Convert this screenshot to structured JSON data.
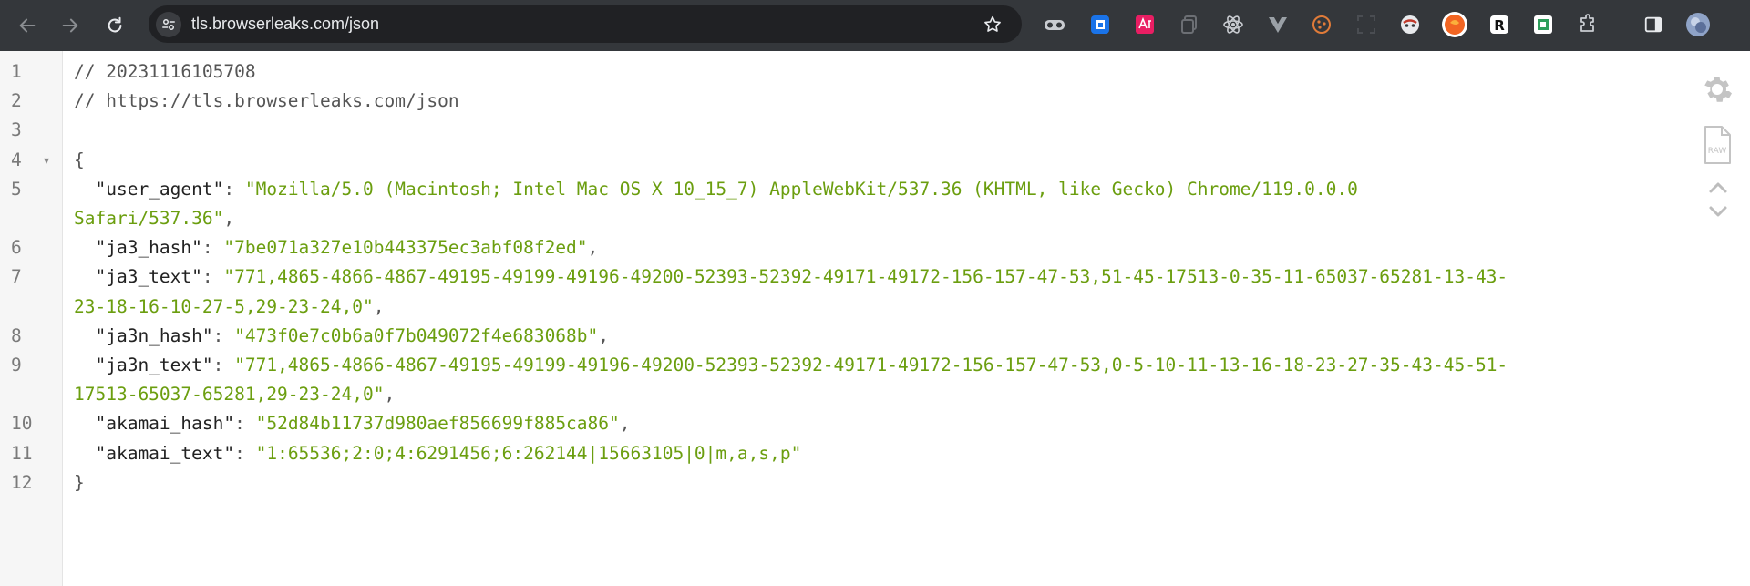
{
  "browser": {
    "url": "tls.browserleaks.com/json",
    "buttons": [
      "back-icon",
      "forward-icon",
      "reload-icon"
    ]
  },
  "extensions": [
    "privacy-mask-icon",
    "translate-extension-icon",
    "extension-icon",
    "copy-extension-icon",
    "react-devtools-icon",
    "vue-devtools-icon",
    "cookie-icon",
    "screenshot-icon",
    "dark-reader-icon",
    "orange-extension-icon",
    "r-extension-icon",
    "green-extension-icon",
    "puzzle-icon",
    "side-panel-icon",
    "profile-avatar"
  ],
  "viewer": {
    "lines": [
      {
        "n": "1",
        "text": "// 20231116105708"
      },
      {
        "n": "2",
        "text": "// https://tls.browserleaks.com/json"
      },
      {
        "n": "3",
        "text": ""
      },
      {
        "n": "4",
        "brace": "{"
      },
      {
        "n": "5",
        "key": "\"user_agent\"",
        "value": "\"Mozilla/5.0 (Macintosh; Intel Mac OS X 10_15_7) AppleWebKit/537.36 (KHTML, like Gecko) Chrome/119.0.0.0",
        "cont": "Safari/537.36\""
      },
      {
        "n": "6",
        "key": "\"ja3_hash\"",
        "value": "\"7be071a327e10b443375ec3abf08f2ed\""
      },
      {
        "n": "7",
        "key": "\"ja3_text\"",
        "value": "\"771,4865-4866-4867-49195-49199-49196-49200-52393-52392-49171-49172-156-157-47-53,51-45-17513-0-35-11-65037-65281-13-43-",
        "cont": "23-18-16-10-27-5,29-23-24,0\""
      },
      {
        "n": "8",
        "key": "\"ja3n_hash\"",
        "value": "\"473f0e7c0b6a0f7b049072f4e683068b\""
      },
      {
        "n": "9",
        "key": "\"ja3n_text\"",
        "value": "\"771,4865-4866-4867-49195-49199-49196-49200-52393-52392-49171-49172-156-157-47-53,0-5-10-11-13-16-18-23-27-35-43-45-51-",
        "cont": "17513-65037-65281,29-23-24,0\""
      },
      {
        "n": "10",
        "key": "\"akamai_hash\"",
        "value": "\"52d84b11737d980aef856699f885ca86\""
      },
      {
        "n": "11",
        "key": "\"akamai_text\"",
        "value": "\"1:65536;2:0;4:6291456;6:262144|15663105|0|m,a,s,p\""
      },
      {
        "n": "12",
        "brace": "}"
      }
    ],
    "colon": ": ",
    "comma": ",",
    "fold_marker": "▾"
  },
  "side_tools": [
    "settings-gear-icon",
    "raw-view-icon",
    "collapse-up-icon",
    "expand-down-icon"
  ],
  "colors": {
    "toolbar": "#34373b",
    "omnibox": "#202124",
    "string": "#6b9e0f",
    "key": "#222222",
    "gutter": "#f6f6f6"
  }
}
